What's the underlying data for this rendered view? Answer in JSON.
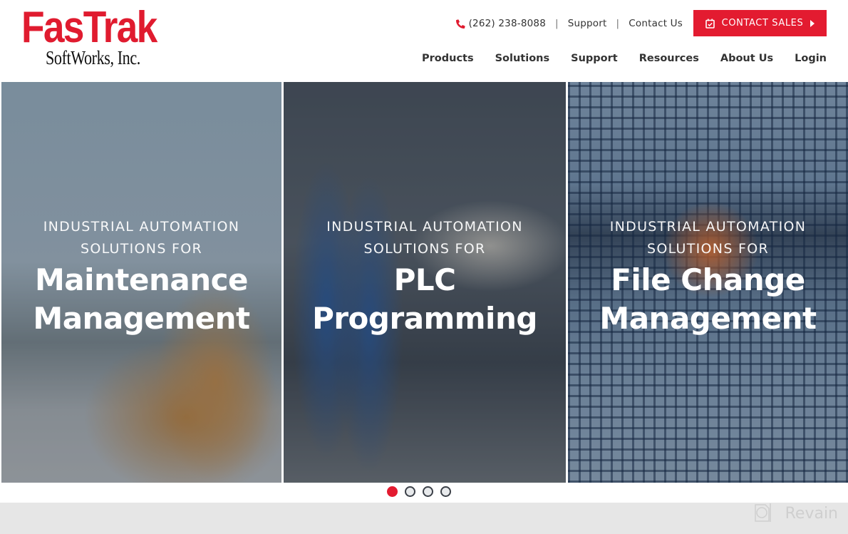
{
  "header": {
    "logo": {
      "main": "FasTrak",
      "sub": "SoftWorks, Inc."
    },
    "utility": {
      "phone_icon": "phone-icon",
      "phone": "(262) 238-8088",
      "separator": "|",
      "support": "Support",
      "contact": "Contact Us"
    },
    "cta": {
      "icon": "calendar-check-icon",
      "label": "CONTACT SALES",
      "caret": "caret-right-icon"
    },
    "nav": [
      {
        "label": "Products"
      },
      {
        "label": "Solutions"
      },
      {
        "label": "Support"
      },
      {
        "label": "Resources"
      },
      {
        "label": "About Us"
      },
      {
        "label": "Login"
      }
    ]
  },
  "hero": {
    "panels": [
      {
        "eyebrow_1": "INDUSTRIAL AUTOMATION",
        "eyebrow_2": "SOLUTIONS FOR",
        "title_1": "Maintenance",
        "title_2": "Management"
      },
      {
        "eyebrow_1": "INDUSTRIAL AUTOMATION",
        "eyebrow_2": "SOLUTIONS FOR",
        "title_1": "PLC",
        "title_2": "Programming"
      },
      {
        "eyebrow_1": "INDUSTRIAL AUTOMATION",
        "eyebrow_2": "SOLUTIONS FOR",
        "title_1": "File Change",
        "title_2": "Management"
      }
    ],
    "carousel": {
      "total_slides": 4,
      "active_slide": 1
    }
  },
  "watermark": {
    "label": "Revain"
  },
  "colors": {
    "brand_red": "#e31b30",
    "text_dark": "#333333",
    "footer_gray": "#e6e6e6"
  }
}
